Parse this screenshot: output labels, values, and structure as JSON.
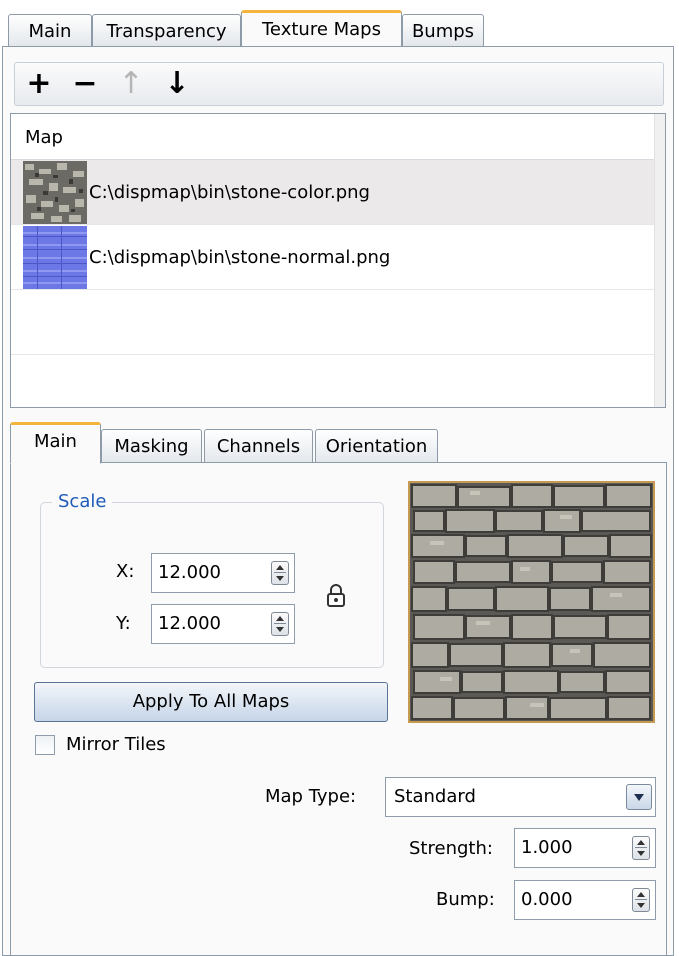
{
  "top_tabs": [
    "Main",
    "Transparency",
    "Texture Maps",
    "Bumps"
  ],
  "toolbar": {
    "add": "+",
    "remove": "−",
    "up": "↑",
    "down": "↓"
  },
  "map_list": {
    "header": "Map",
    "rows": [
      {
        "path": "C:\\dispmap\\bin\\stone-color.png",
        "thumb": "stone-color-thumbnail"
      },
      {
        "path": "C:\\dispmap\\bin\\stone-normal.png",
        "thumb": "stone-normal-thumbnail"
      }
    ]
  },
  "sub_tabs": [
    "Main",
    "Masking",
    "Channels",
    "Orientation"
  ],
  "scale": {
    "legend": "Scale",
    "x_label": "X:",
    "x_value": "12.000",
    "y_label": "Y:",
    "y_value": "12.000"
  },
  "apply_button": "Apply To All Maps",
  "mirror_tiles": {
    "label": "Mirror Tiles",
    "checked": false
  },
  "map_type": {
    "label": "Map Type:",
    "value": "Standard"
  },
  "strength": {
    "label": "Strength:",
    "value": "1.000"
  },
  "bump": {
    "label": "Bump:",
    "value": "0.000"
  },
  "colors": {
    "active_tab_accent": "#f5b53c",
    "legend": "#1e5bb8",
    "normal_map": "#6b78e6"
  }
}
